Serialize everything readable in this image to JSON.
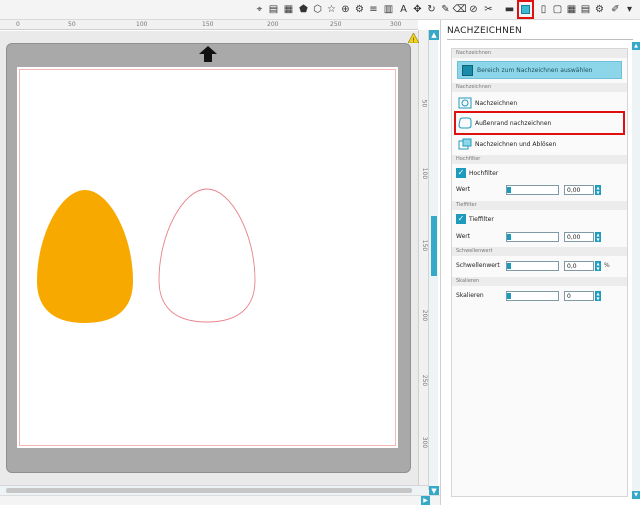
{
  "toolbar": {
    "icons": [
      "select-tool-icon",
      "table-icon",
      "grid-icon",
      "pentagon-icon",
      "hexagon-icon",
      "star-icon",
      "magnify-icon",
      "gear-icon",
      "stripes-icon",
      "color-bars-icon",
      "text-icon",
      "node-icon",
      "rotate-icon",
      "pen-icon",
      "eraser-icon",
      "knife-icon",
      "cutter-icon",
      "store-icon",
      "trace-panel-icon",
      "page-icon",
      "page-setup-icon",
      "grid-view-icon",
      "library-icon",
      "brush-icon",
      "dropdown-icon"
    ]
  },
  "ruler": {
    "h_labels": [
      "0",
      "50",
      "100",
      "150",
      "200",
      "250",
      "300"
    ],
    "v_labels": [
      "50",
      "100",
      "150",
      "200",
      "250",
      "300"
    ]
  },
  "canvas": {
    "egg_fill_color": "#F8A900",
    "egg_outline_color": "#E8828C",
    "sheet_color": "#FFFFFF",
    "mat_color": "#A9A9A9"
  },
  "panel": {
    "title": "NACHZEICHNEN",
    "sections": {
      "trace_area": "Nachzeichnen",
      "select_area_button": "Bereich zum Nachzeichnen auswählen",
      "trace_options": "Nachzeichnen",
      "opt_trace": "Nachzeichnen",
      "opt_outer_edge": "Außenrand nachzeichnen",
      "opt_trace_detach": "Nachzeichnen und Ablösen",
      "highpass_head": "Hochfilter",
      "highpass_check": "Hochfilter",
      "highpass_label": "Wert",
      "highpass_value": "0,00",
      "lowpass_head": "Tieffilter",
      "lowpass_check": "Tieffilter",
      "lowpass_label": "Wert",
      "lowpass_value": "0,00",
      "threshold_head": "Schwellenwert",
      "threshold_label": "Schwellenwert",
      "threshold_value": "0,0",
      "threshold_unit": "%",
      "scale_head": "Skalieren",
      "scale_label": "Skalieren",
      "scale_value": "0"
    }
  }
}
